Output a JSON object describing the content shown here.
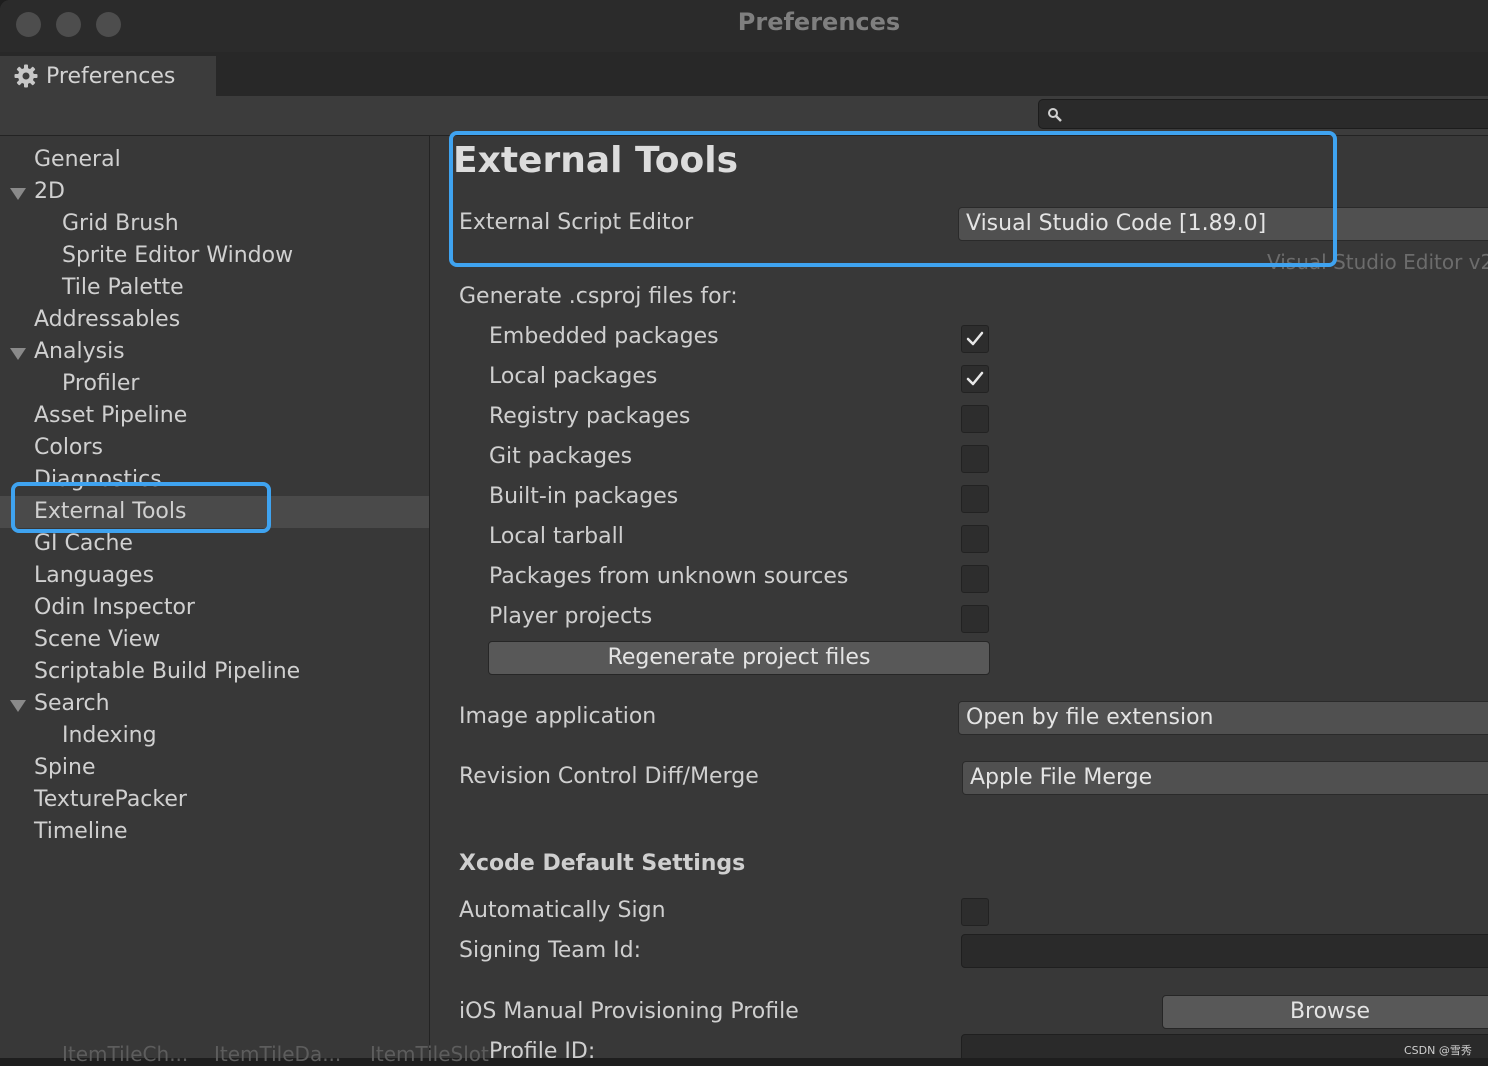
{
  "window": {
    "title": "Preferences",
    "tab_label": "Preferences",
    "search_placeholder": ""
  },
  "sidebar": {
    "items": [
      {
        "label": "General",
        "indent": 0,
        "expanded": null,
        "selected": false
      },
      {
        "label": "2D",
        "indent": 0,
        "expanded": true,
        "selected": false
      },
      {
        "label": "Grid Brush",
        "indent": 1,
        "expanded": null,
        "selected": false
      },
      {
        "label": "Sprite Editor Window",
        "indent": 1,
        "expanded": null,
        "selected": false
      },
      {
        "label": "Tile Palette",
        "indent": 1,
        "expanded": null,
        "selected": false
      },
      {
        "label": "Addressables",
        "indent": 0,
        "expanded": null,
        "selected": false
      },
      {
        "label": "Analysis",
        "indent": 0,
        "expanded": true,
        "selected": false
      },
      {
        "label": "Profiler",
        "indent": 1,
        "expanded": null,
        "selected": false
      },
      {
        "label": "Asset Pipeline",
        "indent": 0,
        "expanded": null,
        "selected": false
      },
      {
        "label": "Colors",
        "indent": 0,
        "expanded": null,
        "selected": false
      },
      {
        "label": "Diagnostics",
        "indent": 0,
        "expanded": null,
        "selected": false
      },
      {
        "label": "External Tools",
        "indent": 0,
        "expanded": null,
        "selected": true
      },
      {
        "label": "GI Cache",
        "indent": 0,
        "expanded": null,
        "selected": false
      },
      {
        "label": "Languages",
        "indent": 0,
        "expanded": null,
        "selected": false
      },
      {
        "label": "Odin Inspector",
        "indent": 0,
        "expanded": null,
        "selected": false
      },
      {
        "label": "Scene View",
        "indent": 0,
        "expanded": null,
        "selected": false
      },
      {
        "label": "Scriptable Build Pipeline",
        "indent": 0,
        "expanded": null,
        "selected": false
      },
      {
        "label": "Search",
        "indent": 0,
        "expanded": true,
        "selected": false
      },
      {
        "label": "Indexing",
        "indent": 1,
        "expanded": null,
        "selected": false
      },
      {
        "label": "Spine",
        "indent": 0,
        "expanded": null,
        "selected": false
      },
      {
        "label": "TexturePacker",
        "indent": 0,
        "expanded": null,
        "selected": false
      },
      {
        "label": "Timeline",
        "indent": 0,
        "expanded": null,
        "selected": false
      }
    ]
  },
  "main": {
    "heading": "External Tools",
    "script_editor_label": "External Script Editor",
    "script_editor_value": "Visual Studio Code [1.89.0]",
    "script_editor_hint": "Visual Studio Editor v2.",
    "generate_label": "Generate .csproj files for:",
    "generate_options": [
      {
        "label": "Embedded packages",
        "checked": true
      },
      {
        "label": "Local packages",
        "checked": true
      },
      {
        "label": "Registry packages",
        "checked": false
      },
      {
        "label": "Git packages",
        "checked": false
      },
      {
        "label": "Built-in packages",
        "checked": false
      },
      {
        "label": "Local tarball",
        "checked": false
      },
      {
        "label": "Packages from unknown sources",
        "checked": false
      },
      {
        "label": "Player projects",
        "checked": false
      }
    ],
    "regenerate_button": "Regenerate project files",
    "image_app_label": "Image application",
    "image_app_value": "Open by file extension",
    "revision_label": "Revision Control Diff/Merge",
    "revision_value": "Apple File Merge",
    "xcode_heading": "Xcode Default Settings",
    "auto_sign_label": "Automatically Sign",
    "auto_sign_checked": false,
    "team_id_label": "Signing Team Id:",
    "team_id_value": "",
    "ios_profile_label": "iOS Manual Provisioning Profile",
    "browse_button": "Browse",
    "profile_id_label": "Profile ID:",
    "profile_id_value": ""
  },
  "background_tabs": [
    "ItemTileCh...",
    "ItemTileDa...",
    "ItemTileSlot"
  ],
  "watermark": "CSDN @雪秀",
  "colors": {
    "highlight": "#3fa3f0",
    "panel": "#383838",
    "titlebar": "#2b2b2b"
  }
}
